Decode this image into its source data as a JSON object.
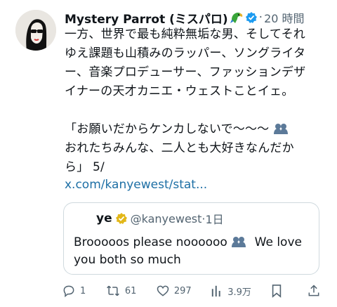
{
  "tweet": {
    "author_name": "Mystery Parrot (ミスパロ)",
    "separator": "·",
    "timestamp": "20 時間",
    "lines": [
      "一方、世界で最も純粋無垢な男、そしてそれ",
      "ゆえ課題も山積みのラッパー、ソングライタ",
      "ー、音楽プロデューサー、ファッションデザ",
      "イナーの天才カニエ・ウェストことイェ。",
      "「お願いだからケンカしないで〜〜〜",
      "おれたちみんな、二人とも大好きなんだか",
      "ら」 5/"
    ],
    "link": "x.com/kanyewest/stat..."
  },
  "quote": {
    "name": "ye",
    "handle": "@kanyewest",
    "separator": "·",
    "time": "1日",
    "line1_part1": "Brooooos please noooooo",
    "line1_part2": "We love",
    "line2": "you both so much"
  },
  "actions": {
    "replies": "1",
    "reposts": "61",
    "likes": "297",
    "views": "3.9万"
  },
  "colors": {
    "link": "#1d6fa5",
    "verified": "#1d9bf0",
    "gold_verified": "#e2b719",
    "muted": "#536471"
  }
}
